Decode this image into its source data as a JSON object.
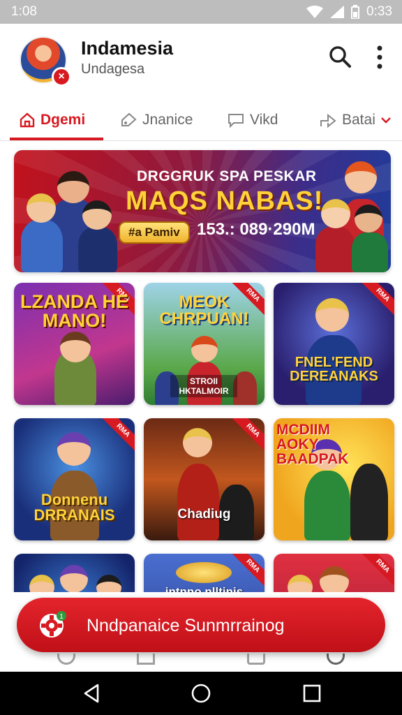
{
  "status_bar": {
    "time": "1:08",
    "clock_right": "0:33",
    "icons": [
      "wifi-icon",
      "signal-icon",
      "battery-icon"
    ]
  },
  "header": {
    "title": "Indamesia",
    "subtitle": "Undagesa",
    "avatar_badge": "×",
    "icons": [
      "search-icon",
      "more-vertical-icon"
    ]
  },
  "tabs": [
    {
      "label": "Dgemi",
      "icon": "home-icon",
      "active": true
    },
    {
      "label": "Jnanice",
      "icon": "tag-icon",
      "active": false
    },
    {
      "label": "Vikd",
      "icon": "chat-bubble-icon",
      "active": false
    },
    {
      "label": "Batai",
      "icon": "share-arrow-icon",
      "active": false
    }
  ],
  "banner": {
    "kicker": "DRGGRUK SPA PESKAR",
    "headline": "MAQS NABAS!",
    "pill": "#a Pamiv",
    "number": "153.: 089·290M"
  },
  "cards": [
    {
      "title": "LZANDA HE MANO!",
      "sub": "",
      "ribbon": "RMA"
    },
    {
      "title": "MEOK CHRPUAN!",
      "sub": "STROII HKTALMOIR",
      "ribbon": "RMA"
    },
    {
      "title": "FNEL'FEND DEREANAKS",
      "sub": "",
      "ribbon": "RMA"
    },
    {
      "title": "Donnenu DRRANAIS",
      "sub": "",
      "ribbon": "RMA"
    },
    {
      "title": "Chadiug",
      "sub": "",
      "ribbon": "RMA"
    },
    {
      "title": "MCDIIM AOKY BAADPAK",
      "sub": "",
      "ribbon": ""
    },
    {
      "title": "",
      "sub": "",
      "ribbon": ""
    },
    {
      "title": "intnno nlltinis",
      "sub": "",
      "ribbon": "RMA"
    },
    {
      "title": "",
      "sub": "",
      "ribbon": "RMA"
    }
  ],
  "cta": {
    "label": "Nndpanaice Sunmrrainog",
    "icon": "gear-icon",
    "badge": "1"
  },
  "nav": {
    "icons": [
      "back-icon",
      "home-circle-icon",
      "recents-icon"
    ]
  },
  "colors": {
    "accent": "#d71921",
    "status_bar": "#bdbdbd"
  }
}
